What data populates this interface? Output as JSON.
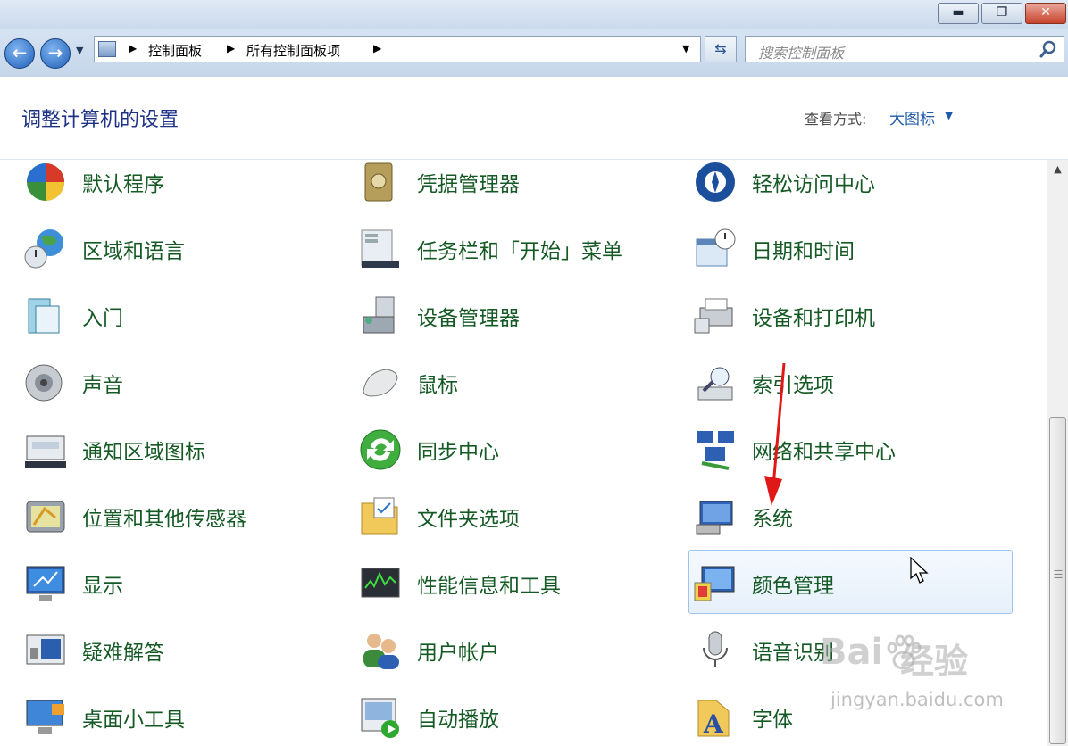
{
  "window": {
    "minimize_glyph": "▬",
    "maximize_glyph": "❐",
    "close_glyph": "✕"
  },
  "nav": {
    "breadcrumbs": [
      "控制面板",
      "所有控制面板项"
    ],
    "search_placeholder": "搜索控制面板"
  },
  "header": {
    "title": "调整计算机的设置",
    "view_label": "查看方式:",
    "view_value": "大图标"
  },
  "items": [
    {
      "label": "默认程序",
      "icon": "default-programs-icon"
    },
    {
      "label": "凭据管理器",
      "icon": "credential-manager-icon"
    },
    {
      "label": "轻松访问中心",
      "icon": "ease-of-access-icon"
    },
    {
      "label": "区域和语言",
      "icon": "region-language-icon"
    },
    {
      "label": "任务栏和「开始」菜单",
      "icon": "taskbar-start-icon"
    },
    {
      "label": "日期和时间",
      "icon": "date-time-icon"
    },
    {
      "label": "入门",
      "icon": "getting-started-icon"
    },
    {
      "label": "设备管理器",
      "icon": "device-manager-icon"
    },
    {
      "label": "设备和打印机",
      "icon": "devices-printers-icon"
    },
    {
      "label": "声音",
      "icon": "sound-icon"
    },
    {
      "label": "鼠标",
      "icon": "mouse-icon"
    },
    {
      "label": "索引选项",
      "icon": "indexing-options-icon"
    },
    {
      "label": "通知区域图标",
      "icon": "notification-area-icon"
    },
    {
      "label": "同步中心",
      "icon": "sync-center-icon"
    },
    {
      "label": "网络和共享中心",
      "icon": "network-sharing-icon"
    },
    {
      "label": "位置和其他传感器",
      "icon": "location-sensors-icon"
    },
    {
      "label": "文件夹选项",
      "icon": "folder-options-icon"
    },
    {
      "label": "系统",
      "icon": "system-icon"
    },
    {
      "label": "显示",
      "icon": "display-icon"
    },
    {
      "label": "性能信息和工具",
      "icon": "performance-icon"
    },
    {
      "label": "颜色管理",
      "icon": "color-management-icon"
    },
    {
      "label": "疑难解答",
      "icon": "troubleshooting-icon"
    },
    {
      "label": "用户帐户",
      "icon": "user-accounts-icon"
    },
    {
      "label": "语音识别",
      "icon": "speech-recognition-icon"
    },
    {
      "label": "桌面小工具",
      "icon": "desktop-gadgets-icon"
    },
    {
      "label": "自动播放",
      "icon": "autoplay-icon"
    },
    {
      "label": "字体",
      "icon": "fonts-icon"
    }
  ],
  "hovered_item": "颜色管理",
  "watermark": {
    "brand_left": "Bai",
    "brand_right": "经验",
    "url": "jingyan.baidu.com"
  },
  "colors": {
    "title_blue": "#1e3287",
    "link_green": "#155a25",
    "annotation_red": "#e01818"
  }
}
